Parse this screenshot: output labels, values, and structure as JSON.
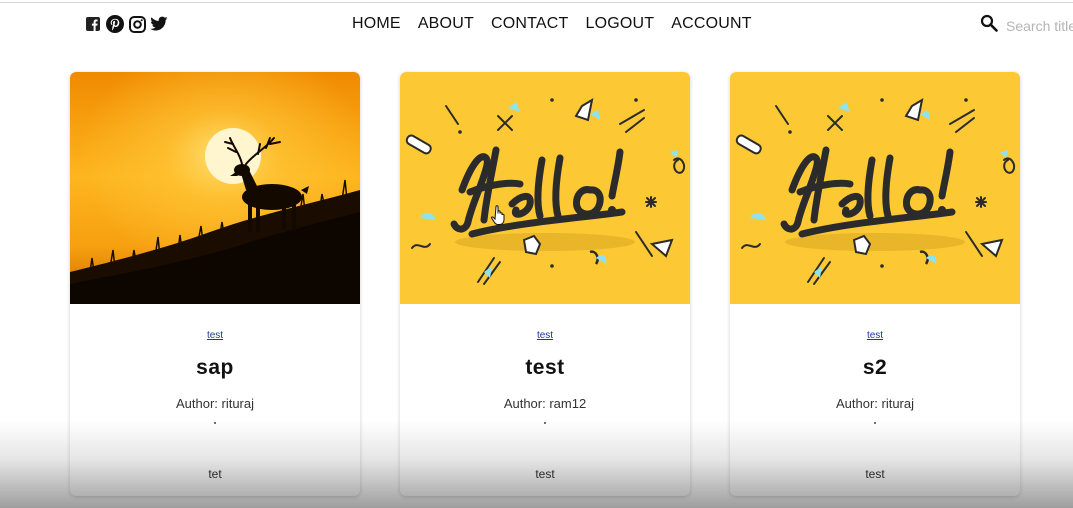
{
  "social": {
    "icons": [
      "facebook-icon",
      "pinterest-icon",
      "instagram-icon",
      "twitter-icon"
    ]
  },
  "nav": {
    "items": [
      "HOME",
      "ABOUT",
      "CONTACT",
      "LOGOUT",
      "ACCOUNT"
    ]
  },
  "search": {
    "placeholder": "Search title"
  },
  "cards": [
    {
      "image": "deer-sunset-photo",
      "tag": "test",
      "title": "sap",
      "author": "Author: rituraj",
      "body": "tet"
    },
    {
      "image": "hello-illustration",
      "tag": "test",
      "title": "test",
      "author": "Author: ram12",
      "body": "test"
    },
    {
      "image": "hello-illustration",
      "tag": "test",
      "title": "s2",
      "author": "Author: rituraj",
      "body": "test"
    }
  ],
  "colors": {
    "hello_background": "#fcc934",
    "sunset_top": "#f08a00",
    "sunset_glow": "#ffd34a",
    "tag_link": "#1a3a9a"
  }
}
